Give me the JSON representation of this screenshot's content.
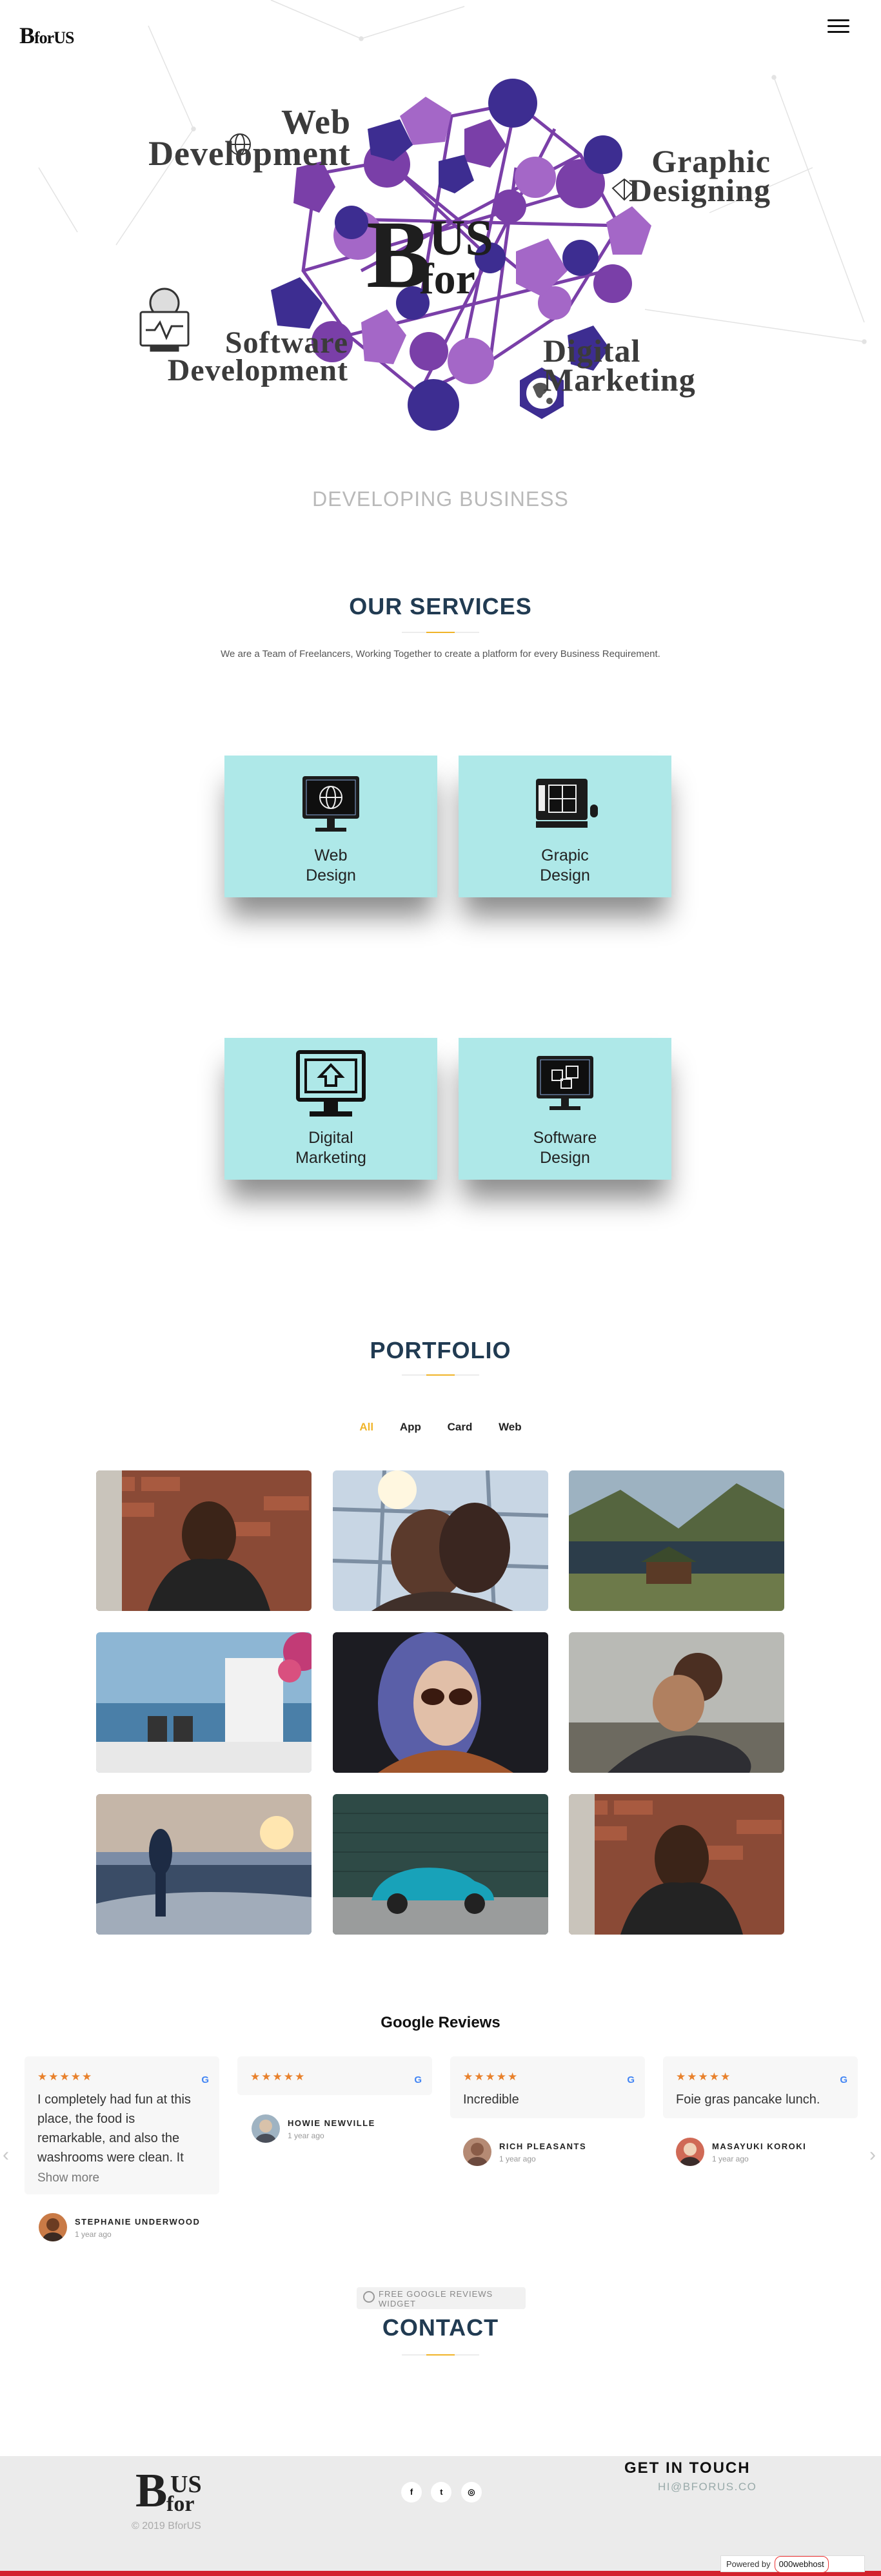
{
  "header": {
    "logo_b": "B",
    "logo_rest": "forUS",
    "menu_icon": "hamburger-icon"
  },
  "hero": {
    "labels": {
      "web": "Web\nDevelopment",
      "graphic": "Graphic\nDesigning",
      "software": "Software\nDevelopment",
      "digital": "Digital\nMarketing"
    },
    "center_logo": {
      "b": "B",
      "us": "US",
      "for": "for"
    },
    "network_colors": {
      "dark": "#3d2d91",
      "mid": "#7a3fa8",
      "light": "#a467c7"
    },
    "tagline": "DEVELOPING BUSINESS"
  },
  "services": {
    "title": "OUR SERVICES",
    "description": "We are a Team of Freelancers, Working Together to create a platform for every Business Requirement.",
    "cards": [
      {
        "label": "Web\nDesign",
        "icon": "web-design-icon"
      },
      {
        "label": "Grapic\nDesign",
        "icon": "graphic-design-icon"
      },
      {
        "label": "Digital\nMarketing",
        "icon": "digital-marketing-icon"
      },
      {
        "label": "Software\nDesign",
        "icon": "software-design-icon"
      }
    ],
    "card_color": "#aee8e8"
  },
  "portfolio": {
    "title": "PORTFOLIO",
    "filters": [
      "All",
      "App",
      "Card",
      "Web"
    ],
    "active_filter": "All",
    "accent": "#f0b429"
  },
  "reviews": {
    "title": "Google Reviews",
    "items": [
      {
        "stars": "★★★★★",
        "text": "I completely had fun at this place, the food is remarkable, and also the washrooms were clean. It",
        "more": "Show more",
        "name": "STEPHANIE UNDERWOOD",
        "time": "1 year ago"
      },
      {
        "stars": "★★★★★",
        "text": "",
        "more": "",
        "name": "HOWIE NEWVILLE",
        "time": "1 year ago"
      },
      {
        "stars": "★★★★★",
        "text": "Incredible",
        "more": "",
        "name": "RICH PLEASANTS",
        "time": "1 year ago"
      },
      {
        "stars": "★★★★★",
        "text": "Foie gras pancake lunch.",
        "more": "",
        "name": "MASAYUKI KOROKI",
        "time": "1 year ago"
      }
    ],
    "google_mark": "G",
    "prev": "‹",
    "next": "›",
    "widget_badge": "FREE GOOGLE REVIEWS WIDGET"
  },
  "contact": {
    "title": "CONTACT"
  },
  "footer": {
    "logo_b": "B",
    "logo_us": "US",
    "logo_for": "for",
    "copyright": "© 2019 BforUS",
    "socials": [
      "f",
      "t",
      "◎"
    ],
    "get_in_touch": "GET IN TOUCH",
    "email": "HI@BFORUS.CO",
    "powered_by": "Powered by",
    "host": "000webhost"
  }
}
